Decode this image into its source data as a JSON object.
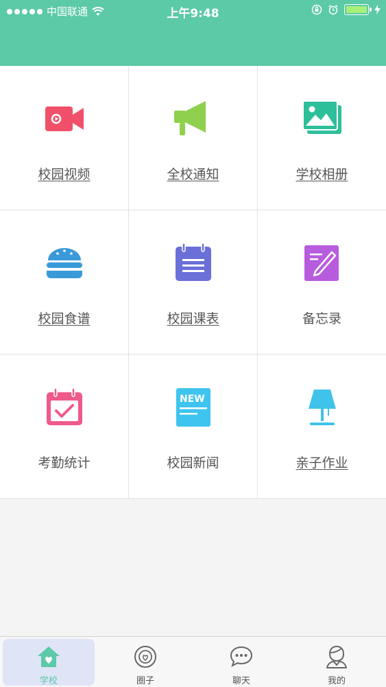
{
  "status_bar": {
    "carrier": "中国联通",
    "time": "上午9:48",
    "icons": [
      "signal-dots-icon",
      "wifi-icon",
      "rotation-lock-icon",
      "alarm-icon",
      "battery-icon",
      "charging-icon"
    ]
  },
  "colors": {
    "header": "#5cc9a7",
    "video": "#f0506a",
    "notice": "#8fd14f",
    "album": "#2dbf9a",
    "recipe": "#3a9ad9",
    "schedule": "#6b6fd8",
    "memo": "#b85cde",
    "attendance": "#ee5a8a",
    "news": "#3ec4ee",
    "homework": "#3fc3ea"
  },
  "grid": {
    "items": [
      {
        "label": "校园视频",
        "icon": "video-camera-icon"
      },
      {
        "label": "全校通知",
        "icon": "megaphone-icon"
      },
      {
        "label": "学校相册",
        "icon": "photo-album-icon"
      },
      {
        "label": "校园食谱",
        "icon": "burger-icon"
      },
      {
        "label": "校园课表",
        "icon": "schedule-notepad-icon"
      },
      {
        "label": "备忘录",
        "icon": "memo-edit-icon"
      },
      {
        "label": "考勤统计",
        "icon": "calendar-check-icon"
      },
      {
        "label": "校园新闻",
        "icon": "news-icon"
      },
      {
        "label": "亲子作业",
        "icon": "desk-lamp-icon"
      }
    ]
  },
  "tabbar": {
    "tabs": [
      {
        "label": "学校",
        "icon": "home-heart-icon",
        "active": true
      },
      {
        "label": "圈子",
        "icon": "circle-heart-icon",
        "active": false
      },
      {
        "label": "聊天",
        "icon": "chat-bubble-icon",
        "active": false
      },
      {
        "label": "我的",
        "icon": "user-profile-icon",
        "active": false
      }
    ]
  }
}
